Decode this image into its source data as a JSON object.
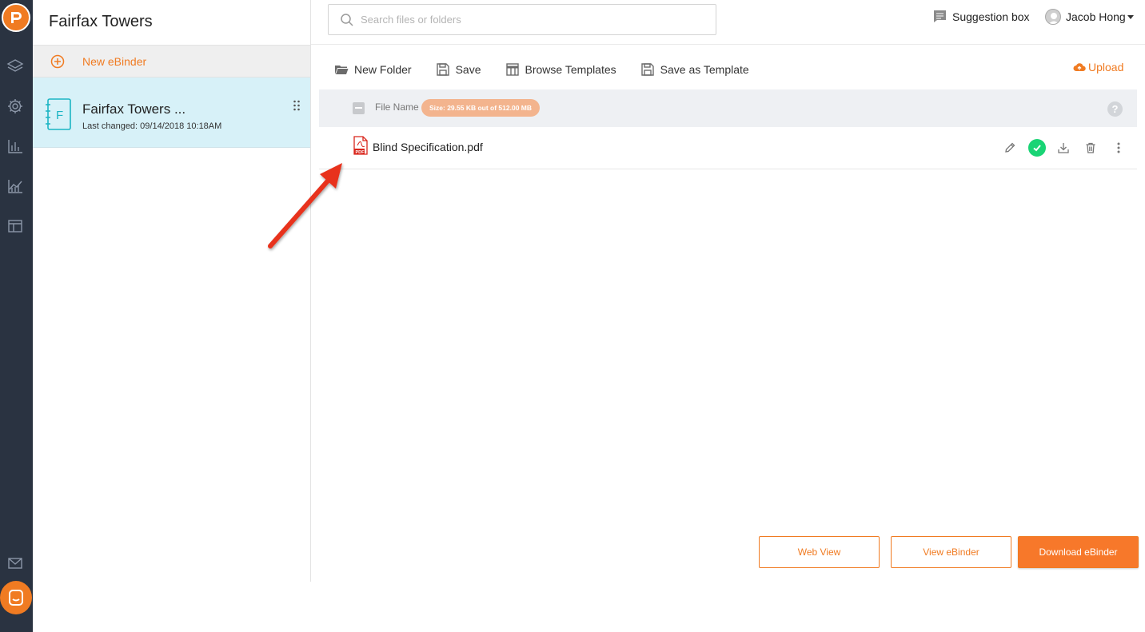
{
  "colors": {
    "accent": "#f07b22",
    "rail": "#2a3341",
    "selected_row": "#d7f1f8",
    "success": "#19d475",
    "size_badge": "#f3b48e"
  },
  "panel": {
    "title": "Fairfax Towers",
    "new_binder_label": "New eBinder",
    "binder": {
      "icon_letter": "F",
      "name": "Fairfax Towers ...",
      "last_changed": "Last changed: 09/14/2018 10:18AM"
    }
  },
  "header": {
    "search_placeholder": "Search files or folders",
    "suggestion_label": "Suggestion box",
    "user_name": "Jacob Hong"
  },
  "toolbar": {
    "new_folder": "New Folder",
    "save": "Save",
    "browse_templates": "Browse Templates",
    "save_as_template": "Save as Template",
    "upload": "Upload"
  },
  "table": {
    "column_file_name": "File Name",
    "size_badge": "Size: 29.55 KB out of 512.00 MB",
    "help_symbol": "?",
    "rows": [
      {
        "name": "Blind Specification.pdf",
        "type_label": "PDF"
      }
    ]
  },
  "footer": {
    "web_view": "Web View",
    "view_ebinder": "View eBinder",
    "download_ebinder": "Download eBinder"
  },
  "icons": [
    "logo-icon",
    "layers-icon",
    "gear-icon",
    "bar-chart-icon",
    "area-chart-icon",
    "layout-icon",
    "mail-icon",
    "chat-icon",
    "search-icon",
    "comment-icon",
    "avatar-icon",
    "folder-open-icon",
    "floppy-icon",
    "template-icon",
    "cloud-upload-icon",
    "pdf-icon",
    "pencil-icon",
    "check-icon",
    "download-icon",
    "trash-icon",
    "more-vertical-icon",
    "drag-handle-icon",
    "annotation-arrow"
  ]
}
